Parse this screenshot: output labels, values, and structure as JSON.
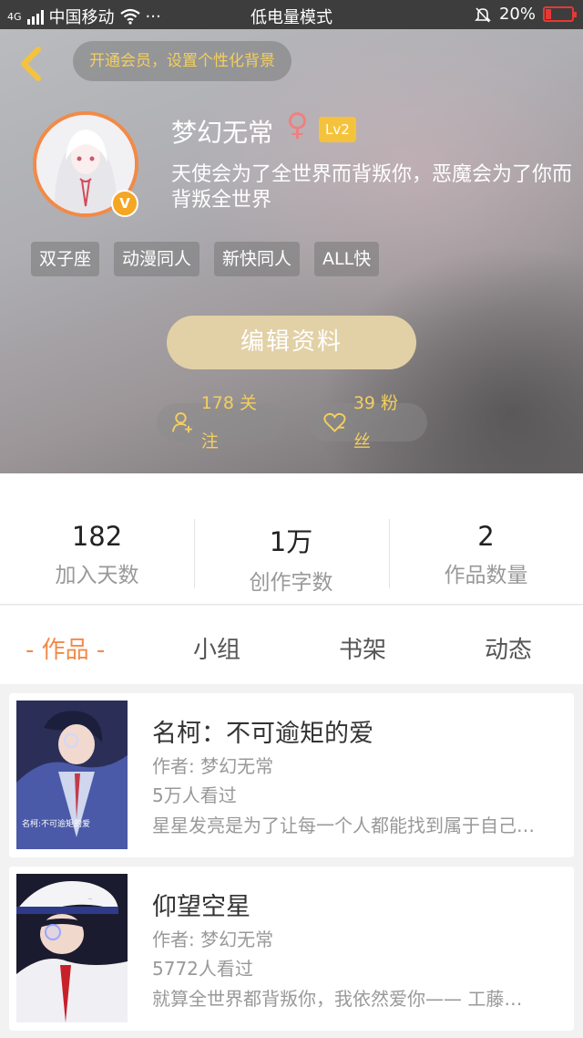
{
  "status_bar": {
    "network": "4G",
    "carrier": "中国移动",
    "more": "···",
    "mode": "低电量模式",
    "battery": "20%",
    "battery_level": 0.2
  },
  "header": {
    "member_prompt": "开通会员，设置个性化背景",
    "username": "梦幻无常",
    "gender_symbol": "♀",
    "level": "Lv2",
    "vip_badge": "V",
    "motto": "天使会为了全世界而背叛你，恶魔会为了你而背叛全世界",
    "tags": [
      "双子座",
      "动漫同人",
      "新快同人",
      "ALL快"
    ],
    "edit_label": "编辑资料",
    "following": "178 关注",
    "fans": "39 粉丝"
  },
  "stats": [
    {
      "value": "182",
      "label": "加入天数"
    },
    {
      "value": "1万",
      "label": "创作字数"
    },
    {
      "value": "2",
      "label": "作品数量"
    }
  ],
  "tabs": [
    "- 作品 -",
    "小组",
    "书架",
    "动态"
  ],
  "works": [
    {
      "title": "名柯：不可逾矩的爱",
      "author": "作者: 梦幻无常",
      "views": "5万人看过",
      "description": "星星发亮是为了让每一个人都能找到属于自己…",
      "cover_text": "名柯:不可逾矩的爱"
    },
    {
      "title": "仰望空星",
      "author": "作者: 梦幻无常",
      "views": "5772人看过",
      "description": "就算全世界都背叛你，我依然爱你—— 工藤…",
      "cover_text": ""
    }
  ],
  "colors": {
    "accent": "#f28a47",
    "gold": "#f3cf5e",
    "edit_button": "#e2d1a6",
    "level_badge": "#f5c33b"
  }
}
